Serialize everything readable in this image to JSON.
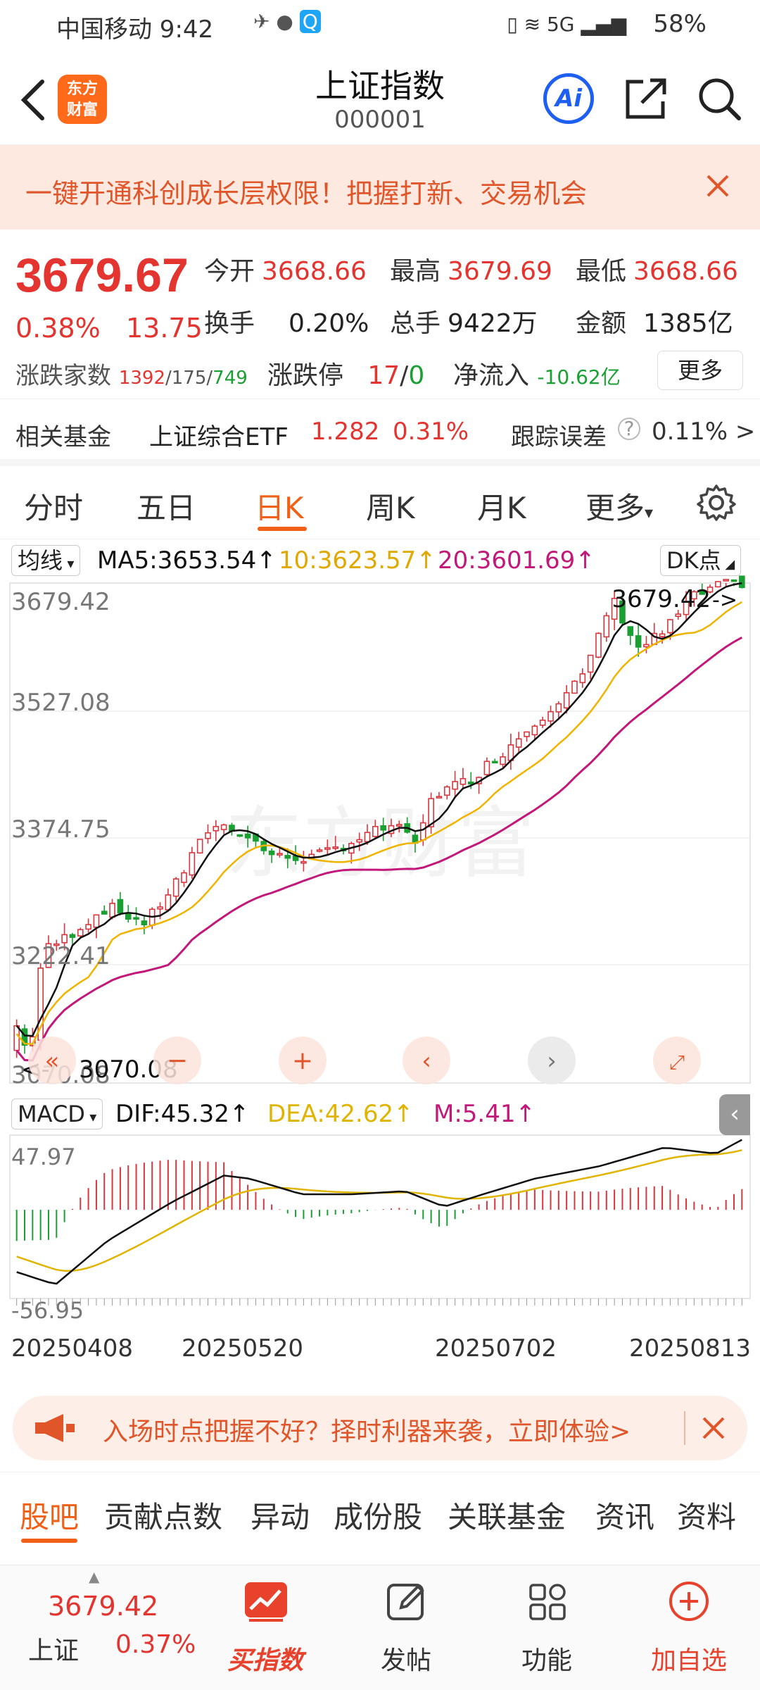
{
  "status": {
    "carrier_time": "中国移动 9:42",
    "battery": "58%",
    "network": "5G"
  },
  "header": {
    "logo_text": "东方\n财富",
    "title": "上证指数",
    "code": "000001",
    "ai_label": "Ai"
  },
  "banner": {
    "text": "一键开通科创成长层权限！把握打新、交易机会"
  },
  "quote": {
    "price": "3679.67",
    "change_pct": "0.38%",
    "change": "13.75",
    "open_label": "今开",
    "open": "3668.66",
    "high_label": "最高",
    "high": "3679.69",
    "low_label": "最低",
    "low": "3668.66",
    "turnover_label": "换手",
    "turnover": "0.20%",
    "volume_label": "总手",
    "volume": "9422万",
    "amount_label": "金额",
    "amount": "1385亿",
    "breadth_label": "涨跌家数",
    "up": "1392",
    "flat": "175",
    "down": "749",
    "limit_label": "涨跌停",
    "limit_up": "17",
    "limit_down": "0",
    "inflow_label": "净流入",
    "inflow": "-10.62亿",
    "more": "更多"
  },
  "fund": {
    "label": "相关基金",
    "name": "上证综合ETF",
    "price": "1.282",
    "pct": "0.31%",
    "err_label": "跟踪误差",
    "err": "0.11% >"
  },
  "tabs": [
    "分时",
    "五日",
    "日K",
    "周K",
    "月K",
    "更多"
  ],
  "chart": {
    "ma_selector": "均线",
    "ma5": "MA5:3653.54",
    "ma10": "10:3623.57",
    "ma20": "20:3601.69",
    "dk": "DK点",
    "macd_selector": "MACD",
    "dif": "DIF:45.32",
    "dea": "DEA:42.62",
    "m": "M:5.41",
    "watermark": "东方财富",
    "colors": {
      "ma5": "#111111",
      "ma10": "#f0b400",
      "ma20": "#c2187a",
      "up": "#d9363e",
      "down": "#1aa032"
    }
  },
  "chart_data": {
    "type": "candlestick",
    "yticks": [
      "3679.42",
      "3527.08",
      "3374.75",
      "3222.41",
      "3070.08"
    ],
    "ylim": [
      3070.08,
      3679.42
    ],
    "max_label": "3679.42",
    "min_label": "3070.08",
    "macd_yticks": [
      "47.97",
      "-56.95"
    ],
    "macd_ylim": [
      -56.95,
      47.97
    ],
    "xticks": [
      "20250408",
      "20250520",
      "20250702",
      "20250813"
    ],
    "ma5_end": 3653.54,
    "ma10_end": 3623.57,
    "ma20_end": 3601.69,
    "dif_end": 45.32,
    "dea_end": 42.62,
    "m_end": 5.41
  },
  "ad": {
    "text": "入场时点把握不好？择时利器来袭，立即体验>"
  },
  "subtabs": [
    "股吧",
    "贡献点数",
    "异动",
    "成份股",
    "关联基金",
    "资讯",
    "资料"
  ],
  "bottombar": {
    "index_value": "3679.42",
    "index_name": "上证",
    "index_pct": "0.37%",
    "buy": "买指数",
    "post": "发帖",
    "func": "功能",
    "add": "加自选"
  }
}
